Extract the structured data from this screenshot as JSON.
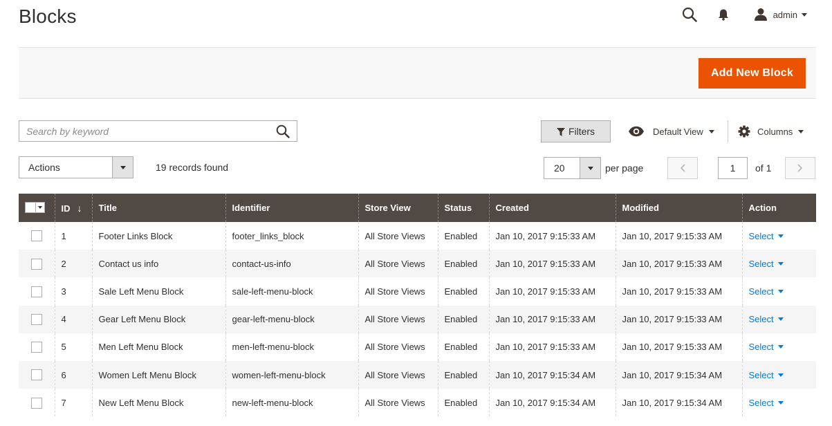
{
  "page": {
    "title": "Blocks"
  },
  "header": {
    "search_icon": "search-icon",
    "notifications_icon": "bell-icon",
    "user": {
      "icon": "user-icon",
      "name": "admin"
    }
  },
  "page_actions": {
    "add_new_label": "Add New Block"
  },
  "toolbar": {
    "search": {
      "placeholder": "Search by keyword",
      "value": ""
    },
    "filters_label": "Filters",
    "view_label": "Default View",
    "columns_label": "Columns",
    "actions_label": "Actions",
    "records_found": "19 records found",
    "per_page_value": "20",
    "per_page_label": "per page",
    "page_current": "1",
    "page_of": "of 1"
  },
  "grid": {
    "columns": [
      "ID",
      "Title",
      "Identifier",
      "Store View",
      "Status",
      "Created",
      "Modified",
      "Action"
    ],
    "sort_indicator": "↓",
    "rows": [
      {
        "id": "1",
        "title": "Footer Links Block",
        "identifier": "footer_links_block",
        "store_view": "All Store Views",
        "status": "Enabled",
        "created": "Jan 10, 2017 9:15:33 AM",
        "modified": "Jan 10, 2017 9:15:33 AM",
        "action": "Select"
      },
      {
        "id": "2",
        "title": "Contact us info",
        "identifier": "contact-us-info",
        "store_view": "All Store Views",
        "status": "Enabled",
        "created": "Jan 10, 2017 9:15:33 AM",
        "modified": "Jan 10, 2017 9:15:33 AM",
        "action": "Select"
      },
      {
        "id": "3",
        "title": "Sale Left Menu Block",
        "identifier": "sale-left-menu-block",
        "store_view": "All Store Views",
        "status": "Enabled",
        "created": "Jan 10, 2017 9:15:33 AM",
        "modified": "Jan 10, 2017 9:15:33 AM",
        "action": "Select"
      },
      {
        "id": "4",
        "title": "Gear Left Menu Block",
        "identifier": "gear-left-menu-block",
        "store_view": "All Store Views",
        "status": "Enabled",
        "created": "Jan 10, 2017 9:15:33 AM",
        "modified": "Jan 10, 2017 9:15:33 AM",
        "action": "Select"
      },
      {
        "id": "5",
        "title": "Men Left Menu Block",
        "identifier": "men-left-menu-block",
        "store_view": "All Store Views",
        "status": "Enabled",
        "created": "Jan 10, 2017 9:15:33 AM",
        "modified": "Jan 10, 2017 9:15:33 AM",
        "action": "Select"
      },
      {
        "id": "6",
        "title": "Women Left Menu Block",
        "identifier": "women-left-menu-block",
        "store_view": "All Store Views",
        "status": "Enabled",
        "created": "Jan 10, 2017 9:15:34 AM",
        "modified": "Jan 10, 2017 9:15:34 AM",
        "action": "Select"
      },
      {
        "id": "7",
        "title": "New Left Menu Block",
        "identifier": "new-left-menu-block",
        "store_view": "All Store Views",
        "status": "Enabled",
        "created": "Jan 10, 2017 9:15:34 AM",
        "modified": "Jan 10, 2017 9:15:34 AM",
        "action": "Select"
      }
    ]
  },
  "colors": {
    "accent": "#eb5202",
    "header_bg": "#514943",
    "link": "#007bdb"
  }
}
